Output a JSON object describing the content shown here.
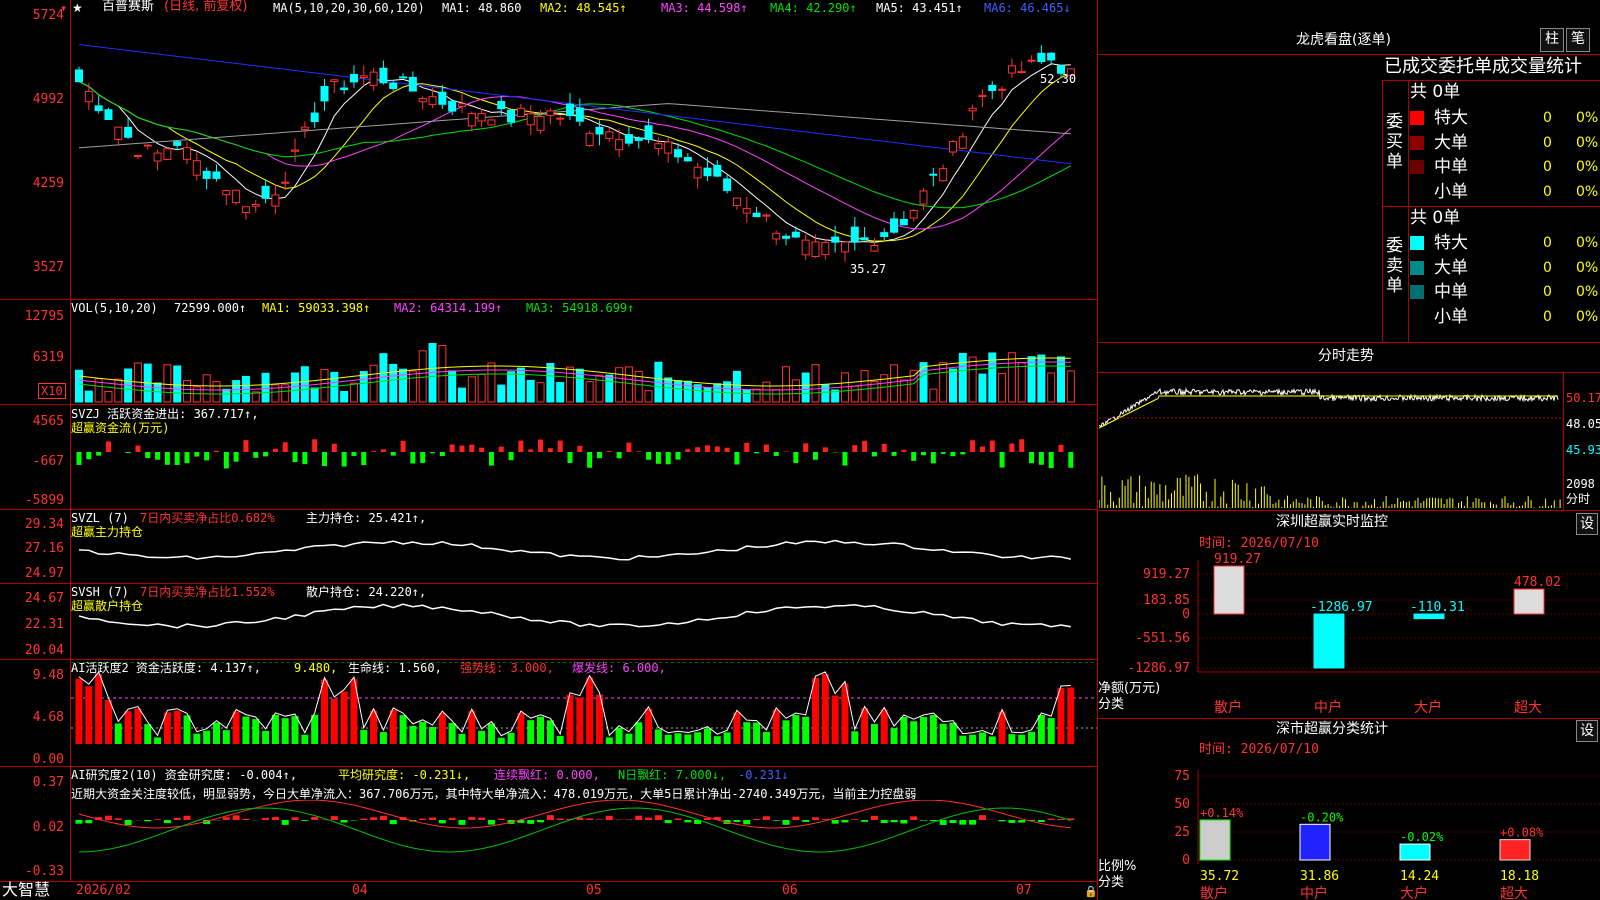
{
  "header": {
    "star": "★",
    "stock_name": "百普赛斯",
    "period": "(日线, 前复权)",
    "ma_params": "MA(5,10,20,30,60,120)",
    "ma1": "MA1: 48.860",
    "ma2": "MA2: 48.545↑",
    "ma3": "MA3: 44.598↑",
    "ma4": "MA4: 42.290↑",
    "ma5": "MA5: 43.451↑",
    "ma6": "MA6: 46.465↓"
  },
  "price_axis": [
    "5724",
    "4992",
    "4259",
    "3527"
  ],
  "price_marks": {
    "high": "52.30",
    "low": "35.27"
  },
  "vol": {
    "params": "VOL(5,10,20)",
    "value": "72599.000↑",
    "ma1": "MA1: 59033.398↑",
    "ma2": "MA2: 64314.199↑",
    "ma3": "MA3: 54918.699↑",
    "axis": [
      "12795",
      "6319"
    ],
    "unit": "X10"
  },
  "svzj": {
    "title": "SVZJ  活跃资金进出: 367.717↑,",
    "subtitle": "超赢资金流(万元)",
    "axis": [
      "4565",
      "-667",
      "-5899"
    ]
  },
  "svzl": {
    "title_a": "SVZL (7)",
    "title_b": "7日内买卖净占比0.682%",
    "title_c": "主力持仓: 25.421↑,",
    "subtitle": "超赢主力持仓",
    "axis": [
      "29.34",
      "27.16",
      "24.97"
    ]
  },
  "svsh": {
    "title_a": "SVSH (7)",
    "title_b": "7日内买卖净占比1.552%",
    "title_c": "散户持仓: 24.220↑,",
    "subtitle": "超赢散户持仓",
    "axis": [
      "24.67",
      "22.31",
      "20.04"
    ]
  },
  "ai1": {
    "title_a": "AI活跃度2  资金活跃度: 4.137↑,",
    "title_b": "9.480,",
    "title_c": "生命线: 1.560,",
    "title_d": "强势线: 3.000,",
    "title_e": "爆发线: 6.000,",
    "axis": [
      "9.48",
      "4.68",
      "0.00"
    ]
  },
  "ai2": {
    "title_a": "AI研究度2(10)  资金研究度: -0.004↑,",
    "title_b": "平均研究度: -0.231↓,",
    "title_c": "连续飘红: 0.000,",
    "title_d": "N日飘红: 7.000↓,",
    "title_e": "-0.231↓",
    "comment": "近期大资金关注度较低，明显弱势，今日大单净流入：367.706万元，其中特大单净流入：478.019万元，大单5日累计净出-2740.349万元，当前主力控盘弱",
    "axis": [
      "0.37",
      "0.02",
      "-0.33"
    ]
  },
  "footer": {
    "brand": "大智慧",
    "months": [
      "2026/02",
      "04",
      "05",
      "06",
      "07"
    ]
  },
  "dragon": {
    "title": "龙虎看盘(逐单)",
    "btn1": "柱",
    "btn2": "笔",
    "subtitle": "已成交委托单成交量统计",
    "buy_label": "委买单",
    "sell_label": "委卖单",
    "buy_total": "共 0单",
    "sell_total": "共 0单",
    "buy_rows": [
      {
        "name": "特大",
        "count": "0",
        "pct": "0%",
        "color": "#ff0000"
      },
      {
        "name": "大单",
        "count": "0",
        "pct": "0%",
        "color": "#8b0000"
      },
      {
        "name": "中单",
        "count": "0",
        "pct": "0%",
        "color": "#6b0000"
      },
      {
        "name": "小单",
        "count": "0",
        "pct": "0%",
        "color": "#000000"
      }
    ],
    "sell_rows": [
      {
        "name": "特大",
        "count": "0",
        "pct": "0%",
        "color": "#00ffff"
      },
      {
        "name": "大单",
        "count": "0",
        "pct": "0%",
        "color": "#008b8b"
      },
      {
        "name": "中单",
        "count": "0",
        "pct": "0%",
        "color": "#007070"
      },
      {
        "name": "小单",
        "count": "0",
        "pct": "0%",
        "color": "#000000"
      }
    ]
  },
  "intraday": {
    "title": "分时走势",
    "axis": [
      "50.17",
      "48.05",
      "45.93"
    ],
    "vol_axis": "2098",
    "vol_label": "分时"
  },
  "sz_monitor": {
    "title": "深圳超赢实时监控",
    "btn": "设",
    "time": "时间: 2026/07/10",
    "axis": [
      "919.27",
      "183.85",
      "0",
      "-551.56",
      "-1286.97"
    ],
    "axis_label1": "净额(万元)",
    "axis_label2": "分类",
    "categories": [
      "散户",
      "中户",
      "大户",
      "超大"
    ],
    "values": [
      919.27,
      -1286.97,
      -110.31,
      478.02
    ],
    "value_labels": [
      "919.27",
      "-1286.97",
      "-110.31",
      "478.02"
    ]
  },
  "sz_class": {
    "title": "深市超赢分类统计",
    "btn": "设",
    "time": "时间: 2026/07/10",
    "axis": [
      "75",
      "50",
      "25",
      "0"
    ],
    "axis_label1": "比例%",
    "axis_label2": "分类",
    "categories": [
      "散户",
      "中户",
      "大户",
      "超大"
    ],
    "values": [
      35.72,
      31.86,
      14.24,
      18.18
    ],
    "changes": [
      "+0.14%",
      "-0.20%",
      "-0.02%",
      "+0.08%"
    ]
  },
  "chart_data": [
    {
      "type": "bar",
      "title": "深圳超赢实时监控",
      "ylabel": "净额(万元)",
      "xlabel": "分类",
      "categories": [
        "散户",
        "中户",
        "大户",
        "超大"
      ],
      "values": [
        919.27,
        -1286.97,
        -110.31,
        478.02
      ],
      "ylim": [
        -1286.97,
        919.27
      ]
    },
    {
      "type": "bar",
      "title": "深市超赢分类统计",
      "ylabel": "比例%",
      "xlabel": "分类",
      "categories": [
        "散户",
        "中户",
        "大户",
        "超大"
      ],
      "values": [
        35.72,
        31.86,
        14.24,
        18.18
      ],
      "ylim": [
        0,
        75
      ]
    }
  ]
}
